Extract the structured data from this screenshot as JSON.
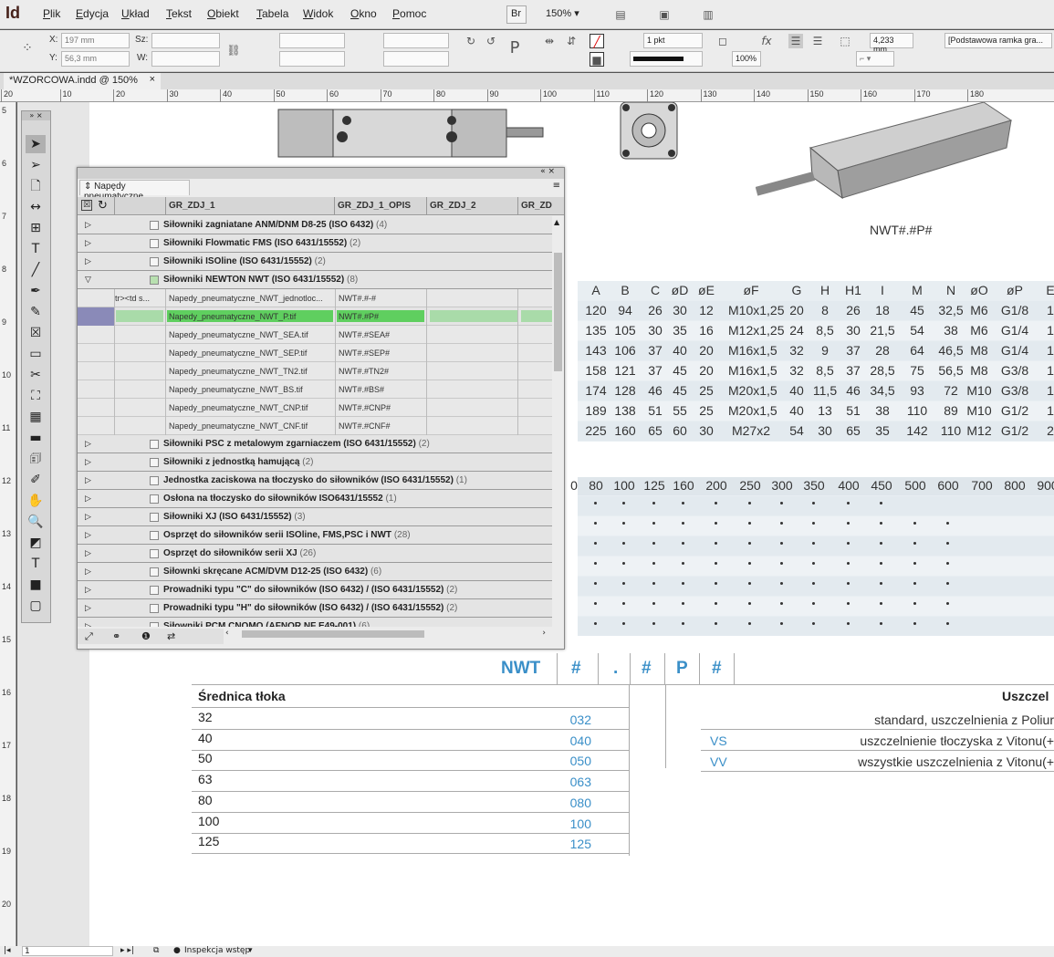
{
  "app": {
    "logo": "Id",
    "zoom": "150%",
    "search_icon": "stock-icon"
  },
  "menu": [
    "Plik",
    "Edycja",
    "Układ",
    "Tekst",
    "Obiekt",
    "Tabela",
    "Widok",
    "Okno",
    "Pomoc"
  ],
  "br_button": "Br",
  "control": {
    "x_label": "X:",
    "y_label": "Y:",
    "x_value": "197 mm",
    "y_value": "56,3 mm",
    "w_label": "W:",
    "h_label": "Sz:",
    "stroke_weight": "1 pkt",
    "stroke_value": "4,233 mm",
    "opacity": "100%",
    "frame_style": "[Podstawowa ramka gra..."
  },
  "doc_tab": {
    "title": "*WZORCOWA.indd @ 150%",
    "close": "×"
  },
  "hruler": [
    "20",
    "10",
    "20",
    "30",
    "40",
    "50",
    "60",
    "70",
    "80",
    "90",
    "100",
    "110",
    "120",
    "130",
    "140",
    "150",
    "160",
    "170",
    "180"
  ],
  "vruler": [
    "5",
    "6",
    "7",
    "8",
    "9",
    "10",
    "11",
    "12",
    "13",
    "14",
    "15",
    "16",
    "17",
    "18",
    "19",
    "20"
  ],
  "page": {
    "product_code": "NWT#.#P#",
    "dim_headers": [
      "A",
      "B",
      "C",
      "øD",
      "øE",
      "øF",
      "G",
      "H",
      "H1",
      "I",
      "M",
      "N",
      "øO",
      "øP",
      "E"
    ],
    "dim_rows": [
      [
        "120",
        "94",
        "26",
        "30",
        "12",
        "M10x1,25",
        "20",
        "8",
        "26",
        "18",
        "45",
        "32,5",
        "M6",
        "G1/8",
        "1"
      ],
      [
        "135",
        "105",
        "30",
        "35",
        "16",
        "M12x1,25",
        "24",
        "8,5",
        "30",
        "21,5",
        "54",
        "38",
        "M6",
        "G1/4",
        "1"
      ],
      [
        "143",
        "106",
        "37",
        "40",
        "20",
        "M16x1,5",
        "32",
        "9",
        "37",
        "28",
        "64",
        "46,5",
        "M8",
        "G1/4",
        "1"
      ],
      [
        "158",
        "121",
        "37",
        "45",
        "20",
        "M16x1,5",
        "32",
        "8,5",
        "37",
        "28,5",
        "75",
        "56,5",
        "M8",
        "G3/8",
        "1"
      ],
      [
        "174",
        "128",
        "46",
        "45",
        "25",
        "M20x1,5",
        "40",
        "11,5",
        "46",
        "34,5",
        "93",
        "72",
        "M10",
        "G3/8",
        "1"
      ],
      [
        "189",
        "138",
        "51",
        "55",
        "25",
        "M20x1,5",
        "40",
        "13",
        "51",
        "38",
        "110",
        "89",
        "M10",
        "G1/2",
        "1"
      ],
      [
        "225",
        "160",
        "65",
        "60",
        "30",
        "M27x2",
        "54",
        "30",
        "65",
        "35",
        "142",
        "110",
        "M12",
        "G1/2",
        "2"
      ]
    ],
    "stroke_headers": [
      "0",
      "80",
      "100",
      "125",
      "160",
      "200",
      "250",
      "300",
      "350",
      "400",
      "450",
      "500",
      "600",
      "700",
      "800",
      "900"
    ],
    "order_parts": [
      "NWT",
      "#",
      ".",
      "#",
      "P",
      "#"
    ],
    "diameter_title": "Średnica tłoka",
    "diameters": [
      [
        "32",
        "032"
      ],
      [
        "40",
        "040"
      ],
      [
        "50",
        "050"
      ],
      [
        "63",
        "063"
      ],
      [
        "80",
        "080"
      ],
      [
        "100",
        "100"
      ],
      [
        "125",
        "125"
      ]
    ],
    "seal_title": "Uszczel",
    "seals": [
      [
        "",
        "standard, uszczelnienia z Poliur"
      ],
      [
        "VS",
        "uszczelnienie tłoczyska z Vitonu(+"
      ],
      [
        "VV",
        "wszystkie uszczelnienia z Vitonu(+"
      ]
    ]
  },
  "panel": {
    "title": "Napędy pneumatyczne",
    "columns": [
      "GR_ZDJ_1",
      "GR_ZDJ_1_OPIS",
      "GR_ZDJ_2",
      "GR_ZD"
    ],
    "groups_top": [
      {
        "name": "Siłowniki zagniatane ANM/DNM D8-25 (ISO 6432)",
        "count": "(4)"
      },
      {
        "name": "Siłowniki Flowmatic FMS (ISO 6431/15552)",
        "count": "(2)"
      },
      {
        "name": "Siłowniki ISOline (ISO 6431/15552)",
        "count": "(2)"
      },
      {
        "name": "Siłowniki NEWTON NWT (ISO 6431/15552)",
        "count": "(8)"
      }
    ],
    "subrows": [
      {
        "c0": "tr><td s...",
        "c1": "Napedy_pneumatyczne_NWT_jednotloc...",
        "c2": "NWT#.#-#"
      },
      {
        "c0": "",
        "c1": "Napedy_pneumatyczne_NWT_P.tif",
        "c2": "NWT#.#P#"
      },
      {
        "c0": "",
        "c1": "Napedy_pneumatyczne_NWT_SEA.tif",
        "c2": "NWT#.#SEA#"
      },
      {
        "c0": "",
        "c1": "Napedy_pneumatyczne_NWT_SEP.tif",
        "c2": "NWT#.#SEP#"
      },
      {
        "c0": "",
        "c1": "Napedy_pneumatyczne_NWT_TN2.tif",
        "c2": "NWT#.#TN2#"
      },
      {
        "c0": "",
        "c1": "Napedy_pneumatyczne_NWT_BS.tif",
        "c2": "NWT#.#BS#"
      },
      {
        "c0": "",
        "c1": "Napedy_pneumatyczne_NWT_CNP.tif",
        "c2": "NWT#.#CNP#"
      },
      {
        "c0": "",
        "c1": "Napedy_pneumatyczne_NWT_CNF.tif",
        "c2": "NWT#.#CNF#"
      }
    ],
    "groups_bottom": [
      {
        "name": "Siłowniki PSC z metalowym zgarniaczem (ISO 6431/15552)",
        "count": "(2)"
      },
      {
        "name": "Siłowniki z jednostką hamującą",
        "count": "(2)"
      },
      {
        "name": "Jednostka zaciskowa na tłoczysko do siłowników (ISO 6431/15552)",
        "count": "(1)"
      },
      {
        "name": "Osłona na tłoczysko do siłowników ISO6431/15552",
        "count": "(1)"
      },
      {
        "name": "Siłowniki XJ (ISO 6431/15552)",
        "count": "(3)"
      },
      {
        "name": "Osprzęt do siłowników serii ISOline, FMS,PSC i NWT",
        "count": "(28)"
      },
      {
        "name": "Osprzęt do siłowników serii XJ",
        "count": "(26)"
      },
      {
        "name": "Siłownki skręcane ACM/DVM D12-25 (ISO 6432)",
        "count": "(6)"
      },
      {
        "name": "Prowadniki typu \"C\" do siłowników (ISO 6432) / (ISO 6431/15552)",
        "count": "(2)"
      },
      {
        "name": "Prowadniki typu \"H\" do siłowników (ISO 6432) / (ISO 6431/15552)",
        "count": "(2)"
      },
      {
        "name": "Siłowniki PCM CNOMO (AFNOR NF E49-001)",
        "count": "(6)"
      }
    ]
  },
  "status": {
    "page": "1",
    "preflight": "Inspekcja wstęp"
  }
}
